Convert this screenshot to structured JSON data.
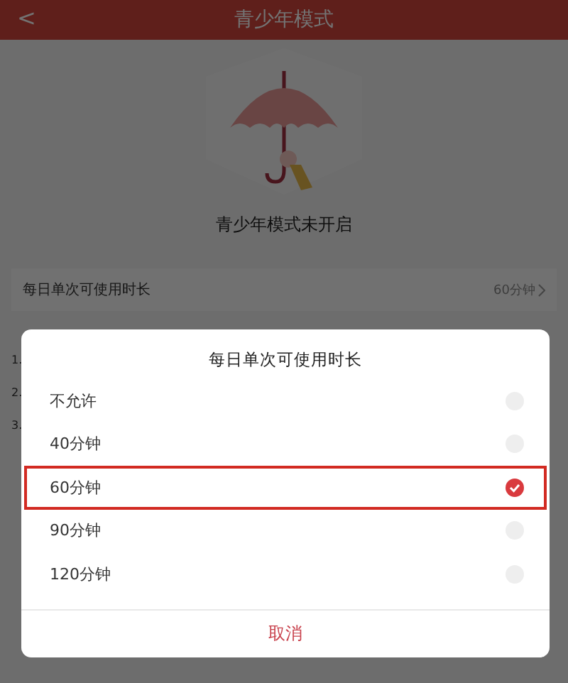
{
  "header": {
    "back": "<",
    "title": "青少年模式"
  },
  "status": "青少年模式未开启",
  "setting": {
    "label": "每日单次可使用时长",
    "value": "60分钟"
  },
  "notes": [
    "1.",
    "2.",
    "3."
  ],
  "dialog": {
    "title": "每日单次可使用时长",
    "options": [
      {
        "label": "不允许",
        "selected": false,
        "highlighted": false
      },
      {
        "label": "40分钟",
        "selected": false,
        "highlighted": false
      },
      {
        "label": "60分钟",
        "selected": true,
        "highlighted": true
      },
      {
        "label": "90分钟",
        "selected": false,
        "highlighted": false
      },
      {
        "label": "120分钟",
        "selected": false,
        "highlighted": false
      }
    ],
    "cancel": "取消"
  }
}
